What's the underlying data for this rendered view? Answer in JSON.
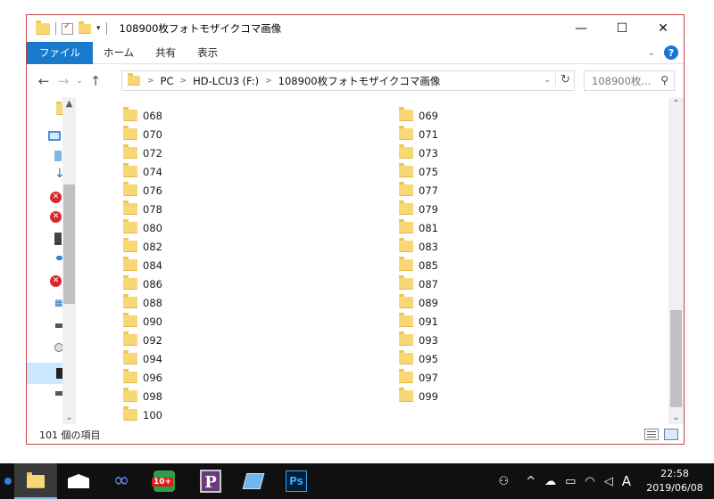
{
  "window": {
    "title": "108900枚フォトモザイクコマ画像",
    "controls": {
      "minimize": "—",
      "maximize": "☐",
      "close": "✕"
    }
  },
  "ribbon": {
    "tabs": [
      "ファイル",
      "ホーム",
      "共有",
      "表示"
    ]
  },
  "address": {
    "crumbs": [
      "PC",
      "HD-LCU3 (F:)",
      "108900枚フォトモザイクコマ画像"
    ],
    "search_placeholder": "108900枚..."
  },
  "files": {
    "left_column": [
      "068",
      "070",
      "072",
      "074",
      "076",
      "078",
      "080",
      "082",
      "084",
      "086",
      "088",
      "090",
      "092",
      "094",
      "096",
      "098",
      "100"
    ],
    "right_column": [
      "069",
      "071",
      "073",
      "075",
      "077",
      "079",
      "081",
      "083",
      "085",
      "087",
      "089",
      "091",
      "093",
      "095",
      "097",
      "099"
    ]
  },
  "status": {
    "item_count": "101 個の項目"
  },
  "taskbar": {
    "badge": "10+",
    "ps_label": "Ps",
    "p_label": "P",
    "ime": "A",
    "time": "22:58",
    "date": "2019/06/08"
  },
  "colors": {
    "accent": "#1979ca",
    "window_border": "#c8424b",
    "folder": "#f8d775",
    "taskbar": "#101010"
  }
}
